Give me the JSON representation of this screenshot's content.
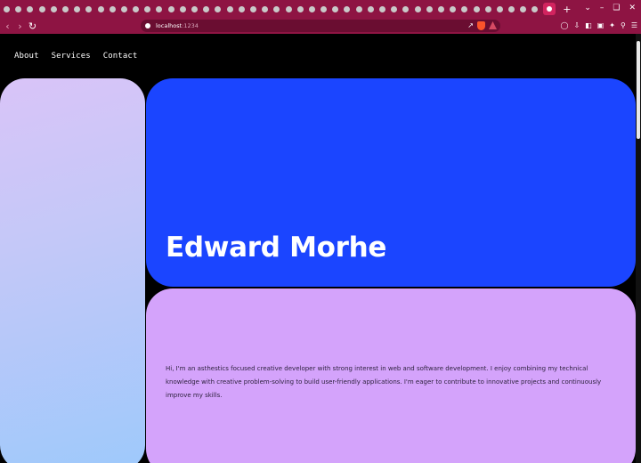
{
  "browser": {
    "url_host": "localhost",
    "url_port": ":1234",
    "new_tab_symbol": "+"
  },
  "nav": {
    "links": [
      "About",
      "Services",
      "Contact"
    ]
  },
  "hero": {
    "name": "Edward Morhe"
  },
  "about": {
    "text": "Hi, I'm an asthestics focused creative developer with strong interest in web and software development. I enjoy combining my technical knowledge with creative problem-solving to build user-friendly applications. I'm eager to contribute to innovative projects and continuously improve my skills."
  },
  "colors": {
    "chrome": "#8e1443",
    "hero_card": "#1b45ff",
    "about_card": "#d4a3fb",
    "left_card_top": "#d9c4f8",
    "left_card_bottom": "#9ec9fb"
  }
}
